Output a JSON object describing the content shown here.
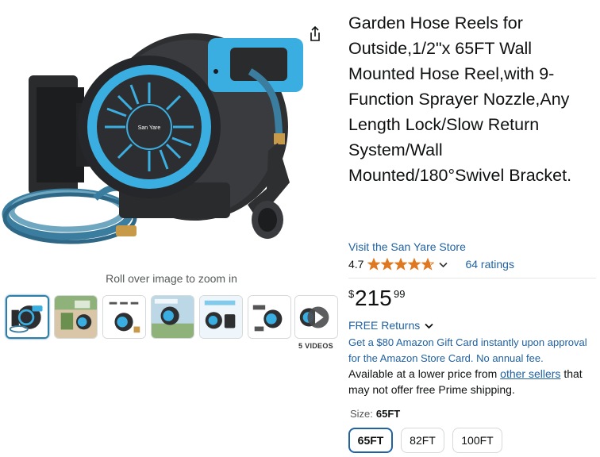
{
  "gallery": {
    "zoom_hint": "Roll over image to zoom in",
    "videos_label": "5 VIDEOS",
    "thumbnails": [
      {
        "name": "thumbnail-1",
        "selected": true
      },
      {
        "name": "thumbnail-2",
        "selected": false
      },
      {
        "name": "thumbnail-3",
        "selected": false
      },
      {
        "name": "thumbnail-4",
        "selected": false
      },
      {
        "name": "thumbnail-5",
        "selected": false
      },
      {
        "name": "thumbnail-6",
        "selected": false
      },
      {
        "name": "thumbnail-videos",
        "selected": false
      }
    ],
    "product_brand_on_reel": "San Yare",
    "share_icon": "share-icon"
  },
  "product": {
    "title": "Garden Hose Reels for Outside,1/2\"x 65FT Wall Mounted Hose Reel,with 9-Function Sprayer Nozzle,Any Length Lock/Slow Return System/Wall Mounted/180°Swivel Bracket.",
    "store_link": "Visit the San Yare Store",
    "rating_value": "4.7",
    "rating_stars": 4.7,
    "ratings_count": "64 ratings",
    "price": {
      "symbol": "$",
      "whole": "215",
      "fraction": "99"
    },
    "free_returns": "FREE Returns",
    "gift_offer": "Get a $80 Amazon Gift Card instantly upon approval for the Amazon Store Card. No annual fee.",
    "availability_prefix": "Available at a lower price from ",
    "availability_link": "other sellers",
    "availability_suffix": " that may not offer free Prime shipping.",
    "size_label": "Size:",
    "size_value": "65FT",
    "size_options": [
      "65FT",
      "82FT",
      "100FT"
    ]
  },
  "colors": {
    "link": "#2162a1",
    "star": "#de7921",
    "accent_blue": "#3aaee0",
    "selected_border": "#2162a1"
  }
}
